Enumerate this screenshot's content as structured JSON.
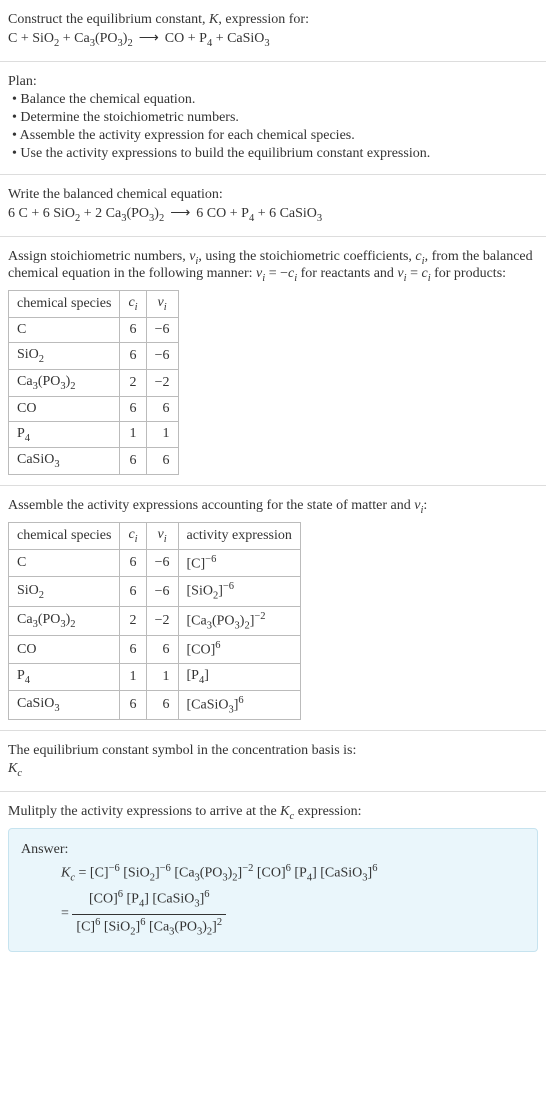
{
  "chart_data": [
    {
      "type": "table",
      "title": "Assign stoichiometric numbers",
      "columns": [
        "chemical species",
        "c_i",
        "ν_i"
      ],
      "rows": [
        [
          "C",
          6,
          -6
        ],
        [
          "SiO2",
          6,
          -6
        ],
        [
          "Ca3(PO3)2",
          2,
          -2
        ],
        [
          "CO",
          6,
          6
        ],
        [
          "P4",
          1,
          1
        ],
        [
          "CaSiO3",
          6,
          6
        ]
      ]
    },
    {
      "type": "table",
      "title": "Activity expressions",
      "columns": [
        "chemical species",
        "c_i",
        "ν_i",
        "activity expression"
      ],
      "rows": [
        [
          "C",
          6,
          -6,
          "[C]^-6"
        ],
        [
          "SiO2",
          6,
          -6,
          "[SiO2]^-6"
        ],
        [
          "Ca3(PO3)2",
          2,
          -2,
          "[Ca3(PO3)2]^-2"
        ],
        [
          "CO",
          6,
          6,
          "[CO]^6"
        ],
        [
          "P4",
          1,
          1,
          "[P4]"
        ],
        [
          "CaSiO3",
          6,
          6,
          "[CaSiO3]^6"
        ]
      ]
    }
  ],
  "intro": {
    "line1_a": "Construct the equilibrium constant, ",
    "K": "K",
    "line1_b": ", expression for:",
    "eq_lhs": "C + SiO",
    "eq_2a": "2",
    "eq_plus1": " + Ca",
    "eq_3": "3",
    "eq_po3": "(PO",
    "eq_3b": "3",
    "eq_close": ")",
    "eq_2b": "2",
    "arrow": "⟶",
    "eq_rhs1": "CO + P",
    "eq_4": "4",
    "eq_rhs2": " + CaSiO",
    "eq_3c": "3"
  },
  "plan": {
    "title": "Plan:",
    "b1": "• Balance the chemical equation.",
    "b2": "• Determine the stoichiometric numbers.",
    "b3": "• Assemble the activity expression for each chemical species.",
    "b4": "• Use the activity expressions to build the equilibrium constant expression."
  },
  "balanced": {
    "title": "Write the balanced chemical equation:",
    "lhs1": "6 C + 6 SiO",
    "s2a": "2",
    "lhs2": " + 2 Ca",
    "s3a": "3",
    "lhs3": "(PO",
    "s3b": "3",
    "lhs4": ")",
    "s2b": "2",
    "arrow": "⟶",
    "rhs1": "6 CO + P",
    "s4": "4",
    "rhs2": " + 6 CaSiO",
    "s3c": "3"
  },
  "assign": {
    "p1": "Assign stoichiometric numbers, ",
    "nu": "ν",
    "i": "i",
    "p2": ", using the stoichiometric coefficients, ",
    "c": "c",
    "p3": ", from the balanced chemical equation in the following manner: ",
    "eq1a": " = −",
    "p4": " for reactants and ",
    "eq2a": " = ",
    "p5": " for products:",
    "th1": "chemical species",
    "th2": "c",
    "th3": "ν",
    "r1s": "C",
    "r1c": "6",
    "r1n": "−6",
    "r2s": "SiO",
    "r2sub": "2",
    "r2c": "6",
    "r2n": "−6",
    "r3s": "Ca",
    "r3sub1": "3",
    "r3s2": "(PO",
    "r3sub2": "3",
    "r3s3": ")",
    "r3sub3": "2",
    "r3c": "2",
    "r3n": "−2",
    "r4s": "CO",
    "r4c": "6",
    "r4n": "6",
    "r5s": "P",
    "r5sub": "4",
    "r5c": "1",
    "r5n": "1",
    "r6s": "CaSiO",
    "r6sub": "3",
    "r6c": "6",
    "r6n": "6"
  },
  "activity": {
    "p1": "Assemble the activity expressions accounting for the state of matter and ",
    "nu": "ν",
    "i": "i",
    "p2": ":",
    "th1": "chemical species",
    "th2": "c",
    "th3": "ν",
    "th4": "activity expression",
    "r1s": "C",
    "r1c": "6",
    "r1n": "−6",
    "r1a1": "[C]",
    "r1a2": "−6",
    "r2s": "SiO",
    "r2sub": "2",
    "r2c": "6",
    "r2n": "−6",
    "r2a1": "[SiO",
    "r2a2": "2",
    "r2a3": "]",
    "r2a4": "−6",
    "r3s": "Ca",
    "r3sub1": "3",
    "r3s2": "(PO",
    "r3sub2": "3",
    "r3s3": ")",
    "r3sub3": "2",
    "r3c": "2",
    "r3n": "−2",
    "r3a1": "[Ca",
    "r3a2": "3",
    "r3a3": "(PO",
    "r3a4": "3",
    "r3a5": ")",
    "r3a6": "2",
    "r3a7": "]",
    "r3a8": "−2",
    "r4s": "CO",
    "r4c": "6",
    "r4n": "6",
    "r4a1": "[CO]",
    "r4a2": "6",
    "r5s": "P",
    "r5sub": "4",
    "r5c": "1",
    "r5n": "1",
    "r5a1": "[P",
    "r5a2": "4",
    "r5a3": "]",
    "r6s": "CaSiO",
    "r6sub": "3",
    "r6c": "6",
    "r6n": "6",
    "r6a1": "[CaSiO",
    "r6a2": "3",
    "r6a3": "]",
    "r6a4": "6"
  },
  "symbol": {
    "p1": "The equilibrium constant symbol in the concentration basis is:",
    "K": "K",
    "c": "c"
  },
  "multiply": {
    "p1": "Mulitply the activity expressions to arrive at the ",
    "K": "K",
    "c": "c",
    "p2": " expression:"
  },
  "answer": {
    "label": "Answer:",
    "Kc_K": "K",
    "Kc_c": "c",
    "eq": " = ",
    "t1": "[C]",
    "e1": "−6",
    "t2": " [SiO",
    "t2s": "2",
    "t2c": "]",
    "e2": "−6",
    "t3": " [Ca",
    "t3s1": "3",
    "t3m": "(PO",
    "t3s2": "3",
    "t3m2": ")",
    "t3s3": "2",
    "t3c": "]",
    "e3": "−2",
    "t4": " [CO]",
    "e4": "6",
    "t5": " [P",
    "t5s": "4",
    "t5c": "]",
    "t6": " [CaSiO",
    "t6s": "3",
    "t6c": "]",
    "e6": "6",
    "eq2": "= ",
    "num1": "[CO]",
    "ne1": "6",
    "num2": " [P",
    "num2s": "4",
    "num2c": "]",
    "num3": " [CaSiO",
    "num3s": "3",
    "num3c": "]",
    "ne3": "6",
    "den1": "[C]",
    "de1": "6",
    "den2": " [SiO",
    "den2s": "2",
    "den2c": "]",
    "de2": "6",
    "den3": " [Ca",
    "den3s1": "3",
    "den3m": "(PO",
    "den3s2": "3",
    "den3m2": ")",
    "den3s3": "2",
    "den3c": "]",
    "de3": "2"
  }
}
